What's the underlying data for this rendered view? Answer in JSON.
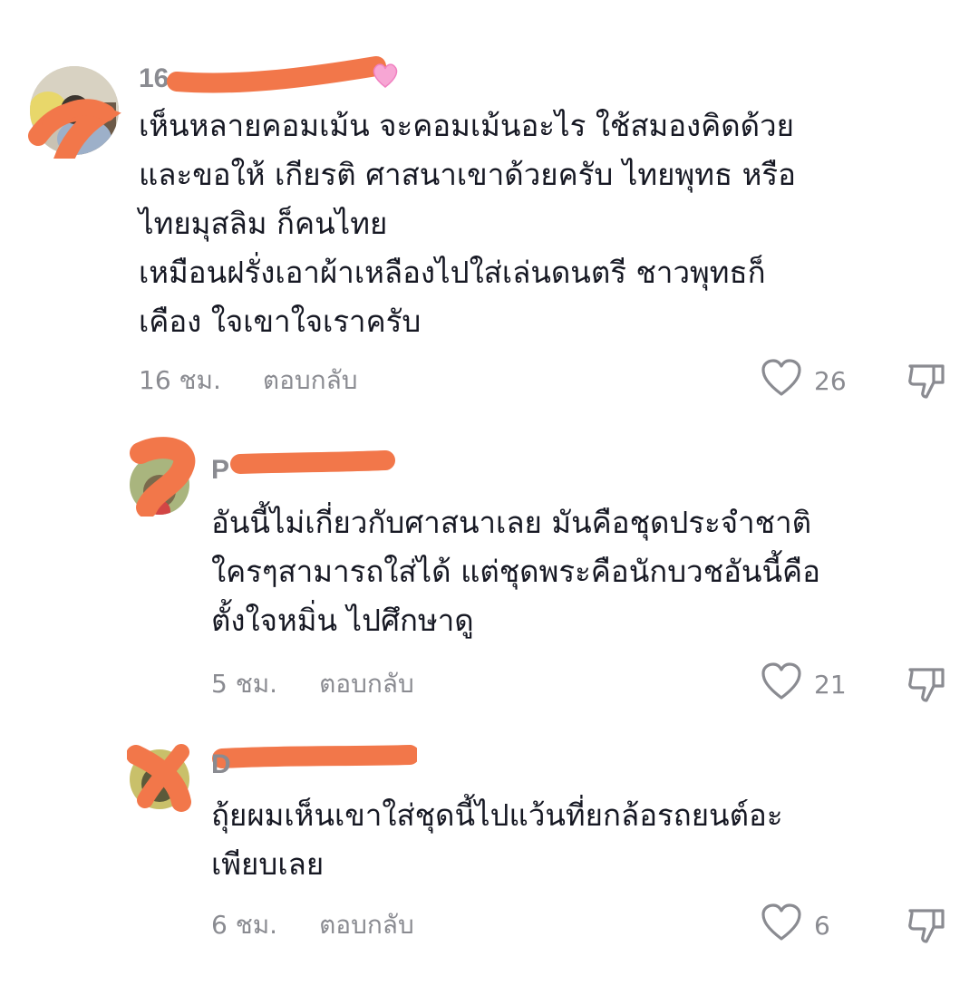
{
  "comments": [
    {
      "username_visible": "16",
      "text": "เห็นหลายคอมเม้น จะคอมเม้นอะไร ใช้สมองคิดด้วย\nและขอให้ เกียรติ ศาสนาเขาด้วยครับ ไทยพุทธ หรือ\nไทยมุสลิม ก็คนไทย\nเหมือนฝรั่งเอาผ้าเหลืองไปใส่เล่นดนตรี ชาวพุทธก็\nเคือง ใจเขาใจเราครับ",
      "time": "16 ชม.",
      "reply_label": "ตอบกลับ",
      "likes": "26"
    },
    {
      "username_visible": "P",
      "text": "อันนี้ไม่เกี่ยวกับศาสนาเลย มันคือชุดประจำชาติ\nใครๆสามารถใส่ได้ แต่ชุดพระคือนักบวชอันนี้คือ\nตั้งใจหมิ่น ไปศึกษาดู",
      "time": "5 ชม.",
      "reply_label": "ตอบกลับ",
      "likes": "21"
    },
    {
      "username_visible": "D",
      "text": "ถุ้ยผมเห็นเขาใส่ชุดนี้ไปแว้นที่ยกล้อรถยนต์อะ\nเพียบเลย",
      "time": "6 ชม.",
      "reply_label": "ตอบกลับ",
      "likes": "6"
    }
  ],
  "icons": {
    "like": "heart-outline-icon",
    "dislike": "thumbs-down-outline-icon"
  },
  "colors": {
    "text": "#161823",
    "muted": "#8a8b91",
    "redaction": "#f2774a"
  }
}
